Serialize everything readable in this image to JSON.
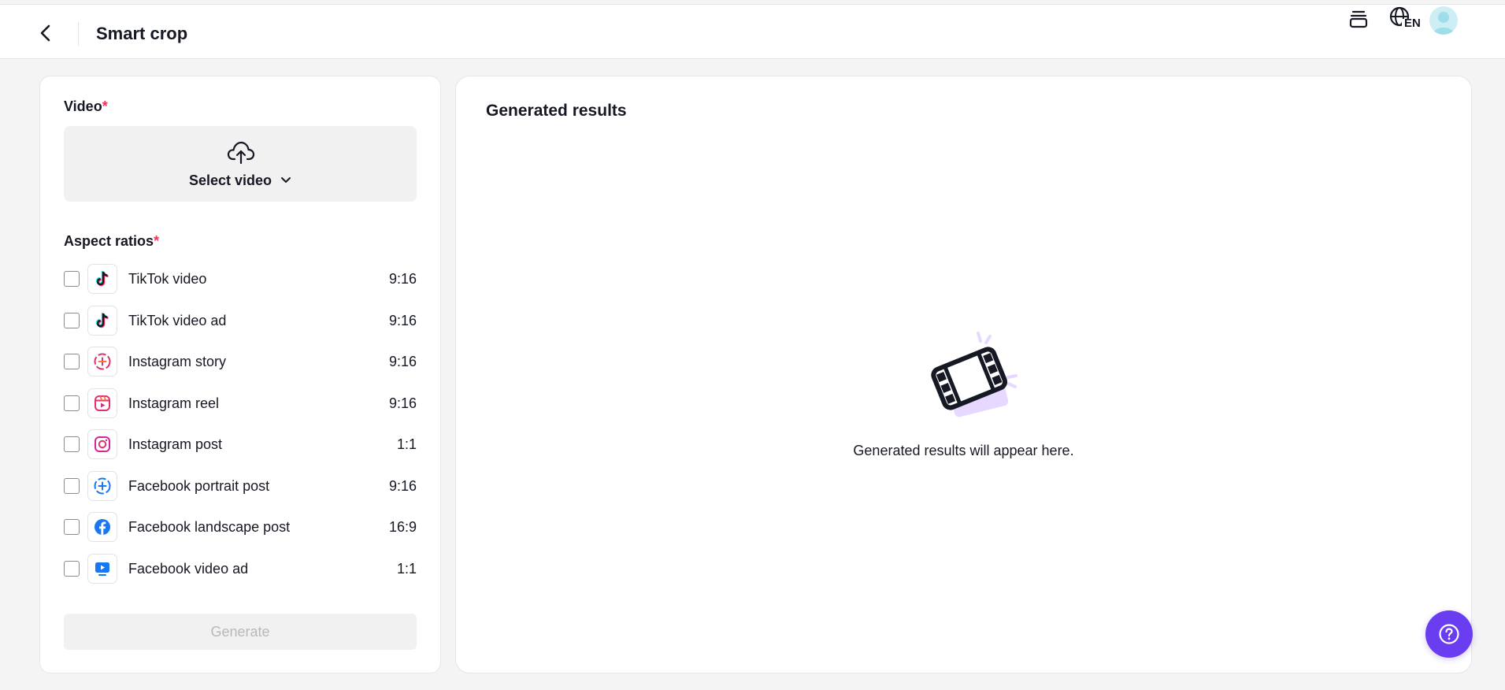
{
  "header": {
    "title": "Smart crop",
    "language_badge": "EN"
  },
  "left_panel": {
    "video_label": "Video",
    "required_mark": "*",
    "upload_label": "Select video",
    "aspect_label": "Aspect ratios",
    "generate_label": "Generate",
    "ratios": [
      {
        "name": "TikTok video",
        "ratio": "9:16",
        "icon": "tiktok-icon"
      },
      {
        "name": "TikTok video ad",
        "ratio": "9:16",
        "icon": "tiktok-icon"
      },
      {
        "name": "Instagram story",
        "ratio": "9:16",
        "icon": "instagram-story-icon"
      },
      {
        "name": "Instagram reel",
        "ratio": "9:16",
        "icon": "instagram-reel-icon"
      },
      {
        "name": "Instagram post",
        "ratio": "1:1",
        "icon": "instagram-icon"
      },
      {
        "name": "Facebook portrait post",
        "ratio": "9:16",
        "icon": "facebook-story-icon"
      },
      {
        "name": "Facebook landscape post",
        "ratio": "16:9",
        "icon": "facebook-icon"
      },
      {
        "name": "Facebook video ad",
        "ratio": "1:1",
        "icon": "facebook-video-icon"
      }
    ]
  },
  "right_panel": {
    "title": "Generated results",
    "empty_text": "Generated results will appear here."
  },
  "colors": {
    "accent": "#6a3df0",
    "required": "#fe2c55",
    "illustration": "#e7d8ff"
  }
}
